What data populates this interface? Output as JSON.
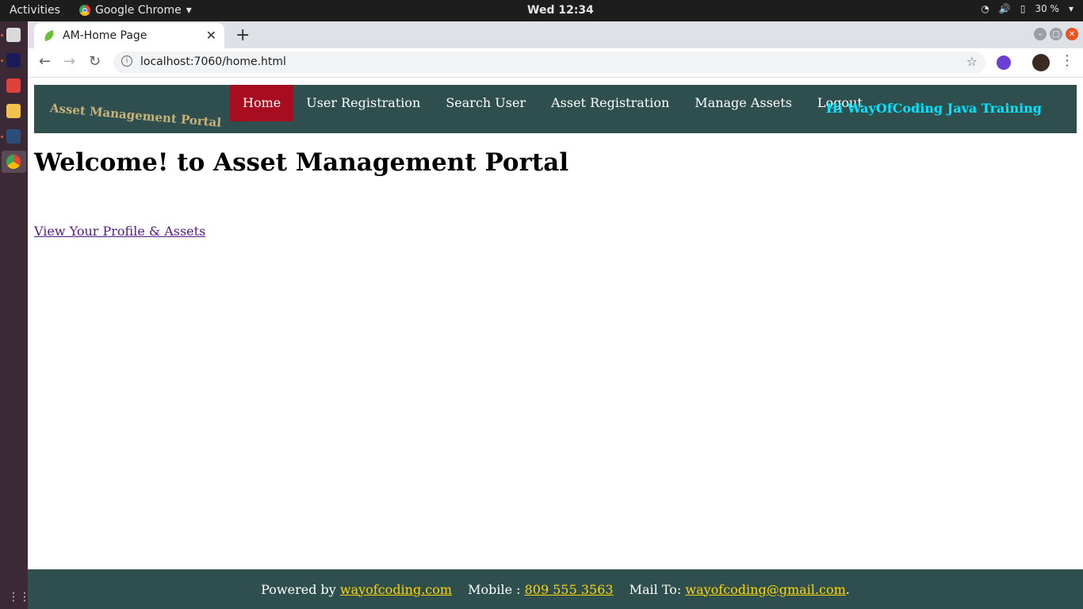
{
  "system": {
    "activities": "Activities",
    "app_name": "Google Chrome",
    "clock": "Wed 12:34",
    "battery": "30 %"
  },
  "browser": {
    "tab_title": "AM-Home Page",
    "url": "localhost:7060/home.html"
  },
  "page": {
    "brand": "Asset Management Portal",
    "nav": [
      "Home",
      "User Registration",
      "Search User",
      "Asset Registration",
      "Manage Assets",
      "Logout"
    ],
    "greeting": "Hi WayOfCoding Java Training",
    "heading": "Welcome! to Asset Management Portal",
    "profile_link": "View Your Profile & Assets"
  },
  "footer": {
    "powered_label": "Powered by",
    "powered_link": "wayofcoding.com",
    "mobile_label": "Mobile :",
    "mobile_link": "809 555 3563",
    "mail_label": "Mail To:",
    "mail_link": "wayofcoding@gmail.com",
    "end": "."
  },
  "colors": {
    "nav_bg": "#2f4f4f",
    "active_nav": "#a80c20",
    "greeting": "#00e5ff",
    "brand": "#c8b27a",
    "footer_link": "#ffd700"
  }
}
